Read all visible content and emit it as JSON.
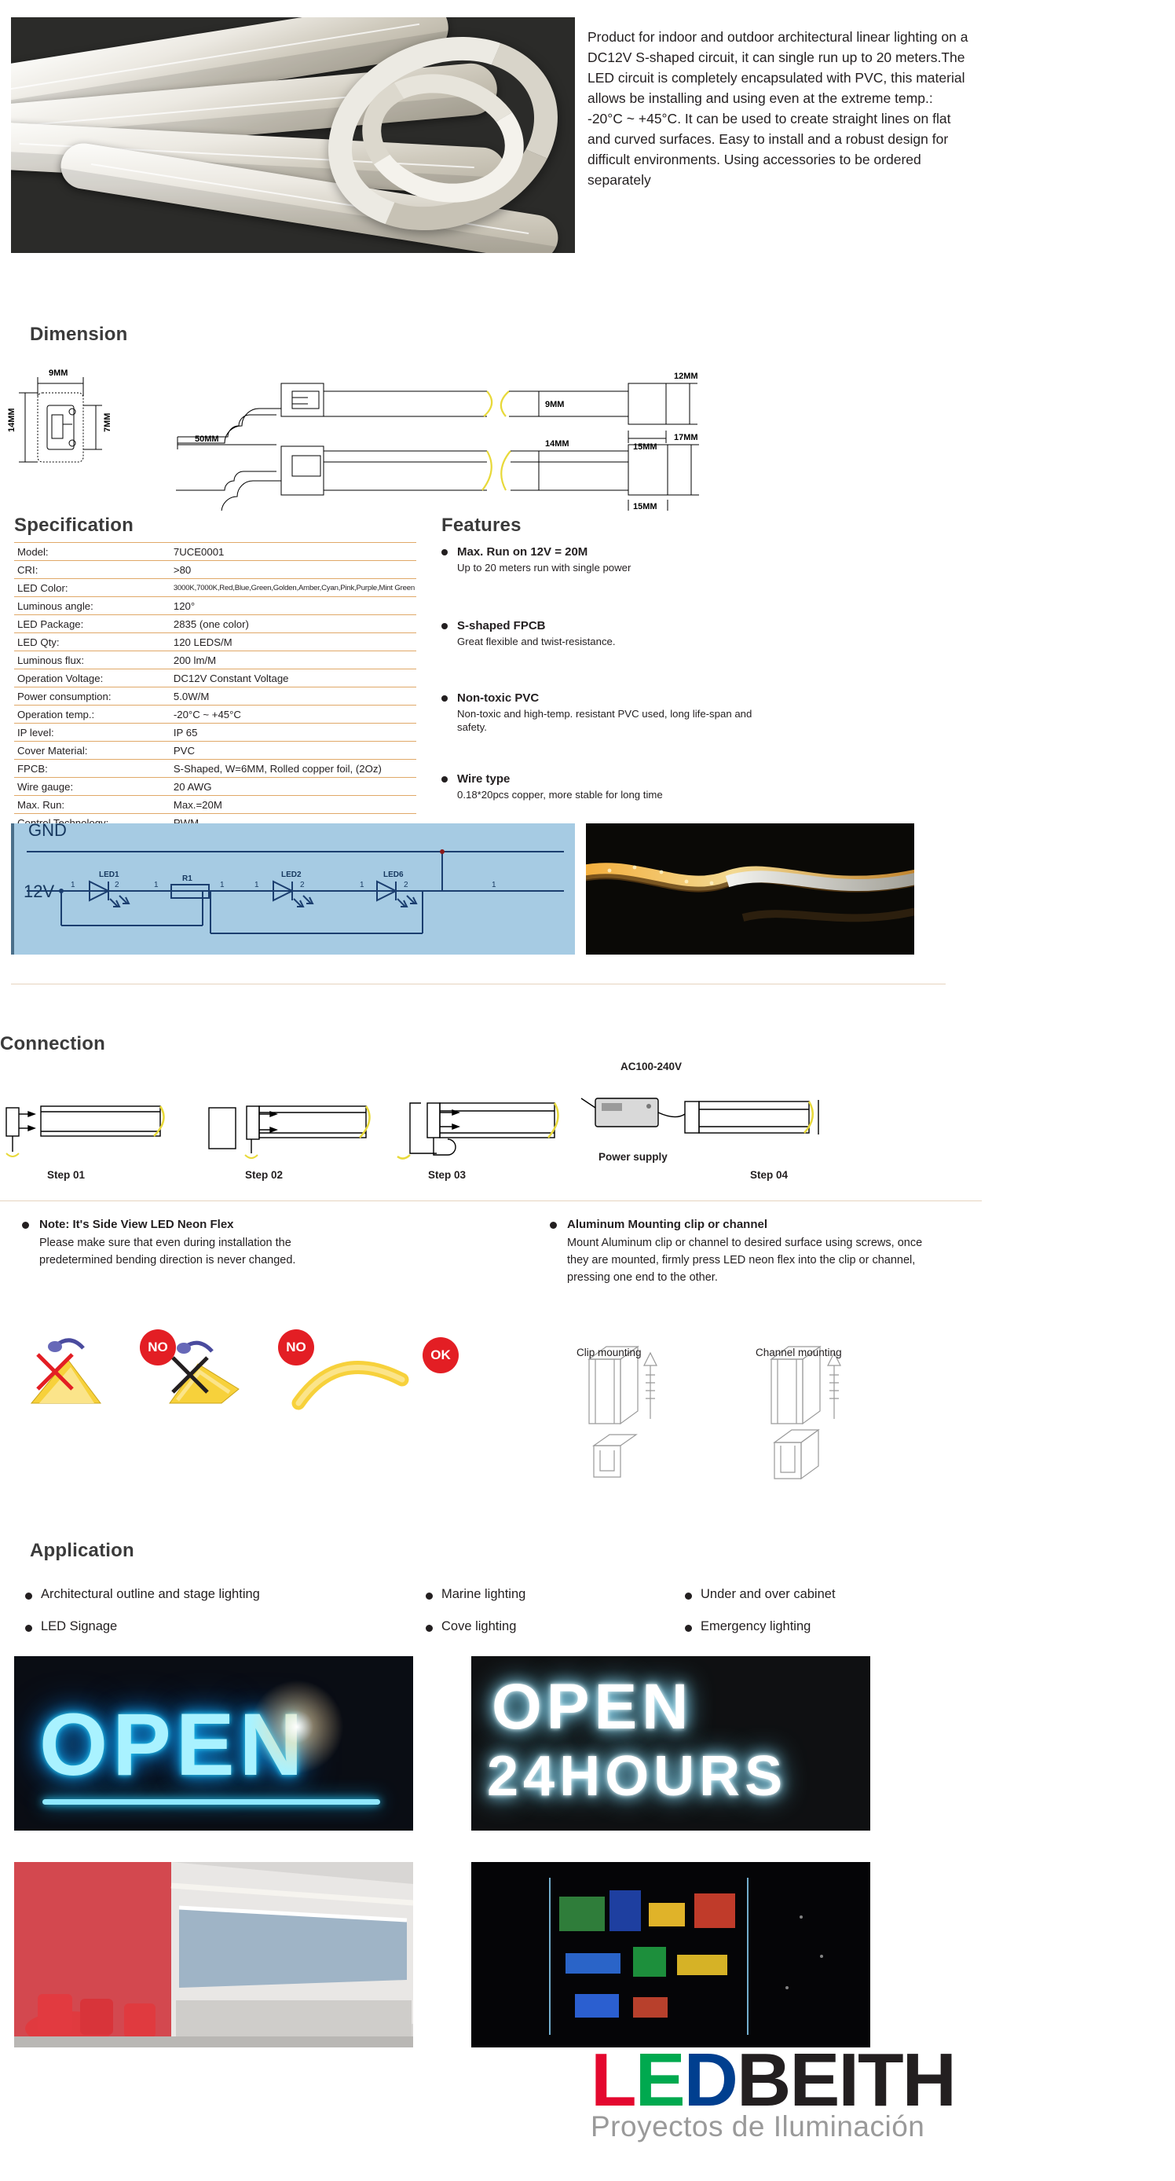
{
  "hero": {
    "description": "Product for indoor and outdoor architectural linear lighting on a DC12V S-shaped circuit, it can single run up to 20 meters.The LED circuit is completely encapsulated with PVC, this material allows be installing and using even at the extreme temp.: -20°C ~ +45°C. It can be used to create straight lines on flat and curved surfaces. Easy to install and a robust design for difficult environments. Using accessories to be ordered separately"
  },
  "dimension": {
    "title": "Dimension",
    "labels": {
      "width_top": "9MM",
      "height_left": "14MM",
      "height_right": "7MM",
      "lead_length": "50MM",
      "profile_h1": "9MM",
      "profile_h2": "14MM",
      "cap_w1": "15MM",
      "cap_w2": "15MM",
      "cap_h1": "12MM",
      "cap_h2": "17MM"
    }
  },
  "specification": {
    "title": "Specification",
    "rows": [
      {
        "key": "Model:",
        "value": "7UCE0001",
        "tiny": false
      },
      {
        "key": "CRI:",
        "value": ">80",
        "tiny": false
      },
      {
        "key": "LED Color:",
        "value": "3000K,7000K,Red,Blue,Green,Golden,Amber,Cyan,Pink,Purple,Mint Green",
        "tiny": true
      },
      {
        "key": "Luminous angle:",
        "value": "120°",
        "tiny": false
      },
      {
        "key": "LED Package:",
        "value": "2835 (one color)",
        "tiny": false
      },
      {
        "key": "LED Qty:",
        "value": "120 LEDS/M",
        "tiny": false
      },
      {
        "key": "Luminous flux:",
        "value": "200 lm/M",
        "tiny": false
      },
      {
        "key": "Operation Voltage:",
        "value": "DC12V Constant Voltage",
        "tiny": false
      },
      {
        "key": "Power consumption:",
        "value": "5.0W/M",
        "tiny": false
      },
      {
        "key": "Operation temp.:",
        "value": "-20°C ~ +45°C",
        "tiny": false
      },
      {
        "key": "IP level:",
        "value": "IP 65",
        "tiny": false
      },
      {
        "key": "Cover Material:",
        "value": "PVC",
        "tiny": false
      },
      {
        "key": "FPCB:",
        "value": "S-Shaped, W=6MM, Rolled copper foil, (2Oz)",
        "tiny": false
      },
      {
        "key": "Wire gauge:",
        "value": "20 AWG",
        "tiny": false
      },
      {
        "key": "Max. Run:",
        "value": "Max.=20M",
        "tiny": false
      },
      {
        "key": "Control Technology:",
        "value": "PWM",
        "tiny": false
      }
    ]
  },
  "features": {
    "title": "Features",
    "items": [
      {
        "title": "Max. Run on 12V = 20M",
        "body": "Up to 20 meters run with single power"
      },
      {
        "title": "S-shaped FPCB",
        "body": "Great flexible and twist-resistance."
      },
      {
        "title": "Non-toxic PVC",
        "body": "Non-toxic and high-temp. resistant PVC used, long life-span and safety."
      },
      {
        "title": "Wire type",
        "body": "0.18*20pcs copper, more stable for long time"
      }
    ]
  },
  "circuit": {
    "gnd_label": "GND",
    "voltage_label": "12V",
    "components": [
      "LED1",
      "R1",
      "LED2",
      "LED6"
    ],
    "node_numbers": [
      "1",
      "2",
      "1",
      "2",
      "1",
      "2",
      "1"
    ]
  },
  "connection": {
    "title": "Connection",
    "steps": [
      "Step 01",
      "Step 02",
      "Step 03",
      "Step 04"
    ],
    "ac_label": "AC100-240V",
    "power_supply_label": "Power supply"
  },
  "notes": {
    "left": {
      "title": "Note: It's Side View LED Neon Flex",
      "body": "Please make sure that even during installation the predetermined bending direction is never changed."
    },
    "right": {
      "title": "Aluminum Mounting clip or channel",
      "body": "Mount Aluminum clip or channel to desired surface using screws, once they are mounted, firmly press LED neon flex into the clip or channel, pressing one end to the other."
    },
    "bend_badges": [
      "NO",
      "NO",
      "OK"
    ],
    "mount_labels": [
      "Clip mounting",
      "Channel mounting"
    ]
  },
  "application": {
    "title": "Application",
    "items": [
      "Architectural outline and stage lighting",
      "Marine lighting",
      "Under and over cabinet",
      "LED Signage",
      "Cove lighting",
      "Emergency lighting"
    ]
  },
  "gallery": {
    "sign1_text": "OPEN",
    "sign2_line1": "OPEN",
    "sign2_line2": "24HOURS"
  },
  "logo": {
    "part_l": "L",
    "part_e": "E",
    "part_d": "D",
    "part_rest": "BEITH",
    "tagline": "Proyectos de Iluminación"
  },
  "colors": {
    "accent_rule": "#e0a868",
    "logo_red": "#e4082f",
    "logo_green": "#00a94f",
    "logo_blue": "#003f8f",
    "logo_dark": "#231f20",
    "badge_red": "#e31e24",
    "circuit_bg": "#a6cbe3"
  }
}
